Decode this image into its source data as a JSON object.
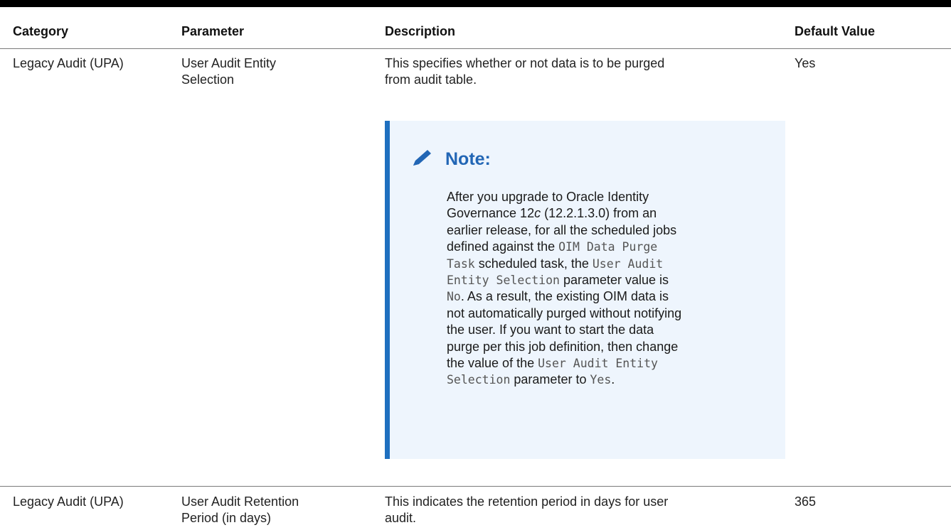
{
  "table": {
    "headers": {
      "category": "Category",
      "parameter": "Parameter",
      "description": "Description",
      "default_value": "Default Value"
    },
    "rows": [
      {
        "category": "Legacy Audit (UPA)",
        "parameter_line1": "User Audit Entity",
        "parameter_line2": "Selection",
        "description_line1": "This specifies whether or not data is to be purged",
        "description_line2": "from audit table.",
        "default_value": "Yes"
      },
      {
        "category": "Legacy Audit (UPA)",
        "parameter_line1": "User Audit Retention",
        "parameter_line2": "Period (in days)",
        "description_line1": "This indicates the retention period in days for user",
        "description_line2": "audit.",
        "default_value": "365"
      }
    ]
  },
  "note": {
    "title": "Note:",
    "icon": "pencil-icon",
    "accent_color": "#1e6fbf",
    "background_color": "#eef5fd",
    "l01": "After you upgrade to Oracle Identity",
    "l02a": "Governance 12",
    "l02b": "c",
    "l02c": " (12.2.1.3.0) from an",
    "l03": "earlier release, for all the scheduled jobs",
    "l04a": "defined against the ",
    "l04b": "OIM Data Purge",
    "l05a": "Task",
    "l05b": " scheduled task, the ",
    "l05c": "User Audit",
    "l06a": "Entity Selection",
    "l06b": " parameter value is",
    "l07a": "No",
    "l07b": ". As a result, the existing OIM data is",
    "l08": "not automatically purged without notifying",
    "l09": "the user. If you want to start the data",
    "l10": "purge per this job definition, then change",
    "l11a": "the value of the ",
    "l11b": "User Audit Entity",
    "l12a": "Selection",
    "l12b": " parameter to ",
    "l12c": "Yes",
    "l12d": "."
  }
}
